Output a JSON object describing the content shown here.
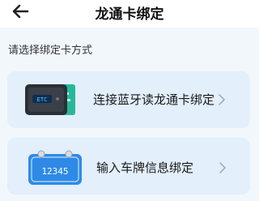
{
  "header": {
    "title": "龙通卡绑定",
    "back_icon": "arrow-left-icon"
  },
  "section": {
    "label": "请选择绑定卡方式"
  },
  "options": [
    {
      "label": "连接蓝牙读龙通卡绑定",
      "icon": "card-reader-icon",
      "chevron": "chevron-right-icon",
      "screen_text": "ETC"
    },
    {
      "label": "输入车牌信息绑定",
      "icon": "license-plate-icon",
      "chevron": "chevron-right-icon",
      "plate_text": "12345"
    }
  ],
  "colors": {
    "background": "#f2f7fc",
    "card": "#e3effb",
    "accent_green": "#27b89a",
    "accent_blue": "#2e8ae6"
  }
}
